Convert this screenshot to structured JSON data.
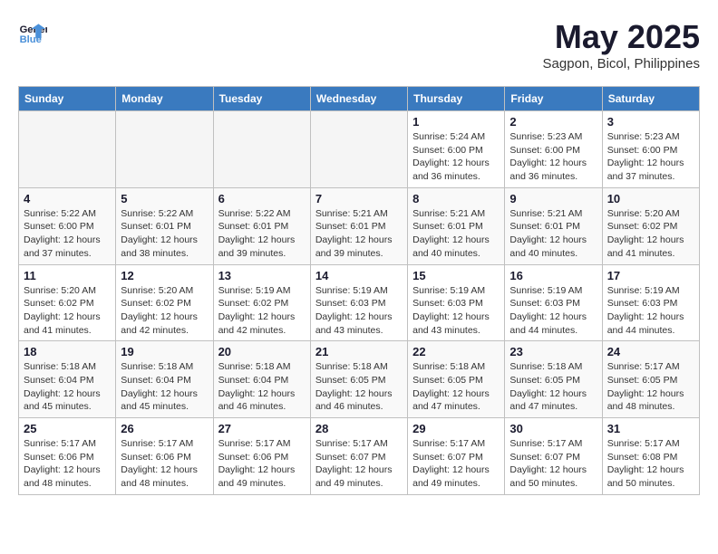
{
  "header": {
    "logo_line1": "General",
    "logo_line2": "Blue",
    "month_year": "May 2025",
    "location": "Sagpon, Bicol, Philippines"
  },
  "weekdays": [
    "Sunday",
    "Monday",
    "Tuesday",
    "Wednesday",
    "Thursday",
    "Friday",
    "Saturday"
  ],
  "weeks": [
    [
      {
        "day": "",
        "info": ""
      },
      {
        "day": "",
        "info": ""
      },
      {
        "day": "",
        "info": ""
      },
      {
        "day": "",
        "info": ""
      },
      {
        "day": "1",
        "info": "Sunrise: 5:24 AM\nSunset: 6:00 PM\nDaylight: 12 hours\nand 36 minutes."
      },
      {
        "day": "2",
        "info": "Sunrise: 5:23 AM\nSunset: 6:00 PM\nDaylight: 12 hours\nand 36 minutes."
      },
      {
        "day": "3",
        "info": "Sunrise: 5:23 AM\nSunset: 6:00 PM\nDaylight: 12 hours\nand 37 minutes."
      }
    ],
    [
      {
        "day": "4",
        "info": "Sunrise: 5:22 AM\nSunset: 6:00 PM\nDaylight: 12 hours\nand 37 minutes."
      },
      {
        "day": "5",
        "info": "Sunrise: 5:22 AM\nSunset: 6:01 PM\nDaylight: 12 hours\nand 38 minutes."
      },
      {
        "day": "6",
        "info": "Sunrise: 5:22 AM\nSunset: 6:01 PM\nDaylight: 12 hours\nand 39 minutes."
      },
      {
        "day": "7",
        "info": "Sunrise: 5:21 AM\nSunset: 6:01 PM\nDaylight: 12 hours\nand 39 minutes."
      },
      {
        "day": "8",
        "info": "Sunrise: 5:21 AM\nSunset: 6:01 PM\nDaylight: 12 hours\nand 40 minutes."
      },
      {
        "day": "9",
        "info": "Sunrise: 5:21 AM\nSunset: 6:01 PM\nDaylight: 12 hours\nand 40 minutes."
      },
      {
        "day": "10",
        "info": "Sunrise: 5:20 AM\nSunset: 6:02 PM\nDaylight: 12 hours\nand 41 minutes."
      }
    ],
    [
      {
        "day": "11",
        "info": "Sunrise: 5:20 AM\nSunset: 6:02 PM\nDaylight: 12 hours\nand 41 minutes."
      },
      {
        "day": "12",
        "info": "Sunrise: 5:20 AM\nSunset: 6:02 PM\nDaylight: 12 hours\nand 42 minutes."
      },
      {
        "day": "13",
        "info": "Sunrise: 5:19 AM\nSunset: 6:02 PM\nDaylight: 12 hours\nand 42 minutes."
      },
      {
        "day": "14",
        "info": "Sunrise: 5:19 AM\nSunset: 6:03 PM\nDaylight: 12 hours\nand 43 minutes."
      },
      {
        "day": "15",
        "info": "Sunrise: 5:19 AM\nSunset: 6:03 PM\nDaylight: 12 hours\nand 43 minutes."
      },
      {
        "day": "16",
        "info": "Sunrise: 5:19 AM\nSunset: 6:03 PM\nDaylight: 12 hours\nand 44 minutes."
      },
      {
        "day": "17",
        "info": "Sunrise: 5:19 AM\nSunset: 6:03 PM\nDaylight: 12 hours\nand 44 minutes."
      }
    ],
    [
      {
        "day": "18",
        "info": "Sunrise: 5:18 AM\nSunset: 6:04 PM\nDaylight: 12 hours\nand 45 minutes."
      },
      {
        "day": "19",
        "info": "Sunrise: 5:18 AM\nSunset: 6:04 PM\nDaylight: 12 hours\nand 45 minutes."
      },
      {
        "day": "20",
        "info": "Sunrise: 5:18 AM\nSunset: 6:04 PM\nDaylight: 12 hours\nand 46 minutes."
      },
      {
        "day": "21",
        "info": "Sunrise: 5:18 AM\nSunset: 6:05 PM\nDaylight: 12 hours\nand 46 minutes."
      },
      {
        "day": "22",
        "info": "Sunrise: 5:18 AM\nSunset: 6:05 PM\nDaylight: 12 hours\nand 47 minutes."
      },
      {
        "day": "23",
        "info": "Sunrise: 5:18 AM\nSunset: 6:05 PM\nDaylight: 12 hours\nand 47 minutes."
      },
      {
        "day": "24",
        "info": "Sunrise: 5:17 AM\nSunset: 6:05 PM\nDaylight: 12 hours\nand 48 minutes."
      }
    ],
    [
      {
        "day": "25",
        "info": "Sunrise: 5:17 AM\nSunset: 6:06 PM\nDaylight: 12 hours\nand 48 minutes."
      },
      {
        "day": "26",
        "info": "Sunrise: 5:17 AM\nSunset: 6:06 PM\nDaylight: 12 hours\nand 48 minutes."
      },
      {
        "day": "27",
        "info": "Sunrise: 5:17 AM\nSunset: 6:06 PM\nDaylight: 12 hours\nand 49 minutes."
      },
      {
        "day": "28",
        "info": "Sunrise: 5:17 AM\nSunset: 6:07 PM\nDaylight: 12 hours\nand 49 minutes."
      },
      {
        "day": "29",
        "info": "Sunrise: 5:17 AM\nSunset: 6:07 PM\nDaylight: 12 hours\nand 49 minutes."
      },
      {
        "day": "30",
        "info": "Sunrise: 5:17 AM\nSunset: 6:07 PM\nDaylight: 12 hours\nand 50 minutes."
      },
      {
        "day": "31",
        "info": "Sunrise: 5:17 AM\nSunset: 6:08 PM\nDaylight: 12 hours\nand 50 minutes."
      }
    ]
  ]
}
